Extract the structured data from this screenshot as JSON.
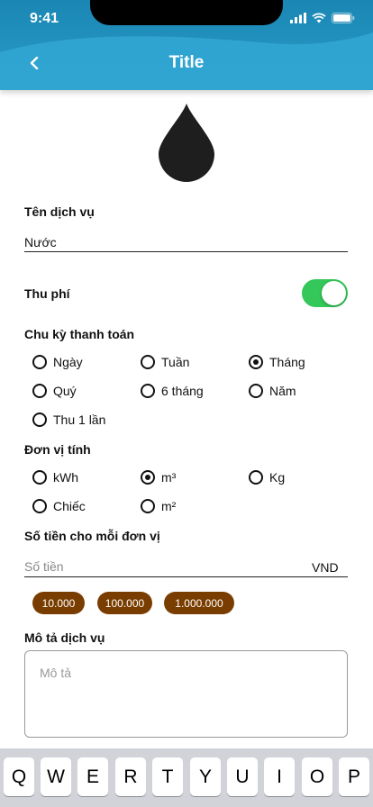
{
  "status_bar": {
    "time": "9:41"
  },
  "header": {
    "title": "Title"
  },
  "colors": {
    "header_top": "#1a86b3",
    "header_wave": "#32a7d3",
    "toggle_on": "#34c759",
    "chip_bg": "#7a3d00"
  },
  "form": {
    "service_name": {
      "label": "Tên dịch vụ",
      "value": "Nước"
    },
    "fee": {
      "label": "Thu phí",
      "enabled": true
    },
    "billing_cycle": {
      "label": "Chu kỳ thanh toán",
      "options": [
        "Ngày",
        "Tuần",
        "Tháng",
        "Quý",
        "6 tháng",
        "Năm",
        "Thu 1 lần"
      ],
      "selected": "Tháng"
    },
    "unit": {
      "label": "Đơn vị tính",
      "options": [
        "kWh",
        "m³",
        "Kg",
        "Chiếc",
        "m²"
      ],
      "selected": "m³"
    },
    "amount": {
      "label": "Số tiền cho mỗi đơn vị",
      "placeholder": "Số tiền",
      "value": "",
      "currency": "VND",
      "quick_amounts": [
        "10.000",
        "100.000",
        "1.000.000"
      ]
    },
    "description": {
      "label": "Mô tả dịch vụ",
      "placeholder": "Mô tả",
      "value": ""
    }
  },
  "keyboard": {
    "keys": [
      "Q",
      "W",
      "E",
      "R",
      "T",
      "Y",
      "U",
      "I",
      "O",
      "P"
    ]
  }
}
